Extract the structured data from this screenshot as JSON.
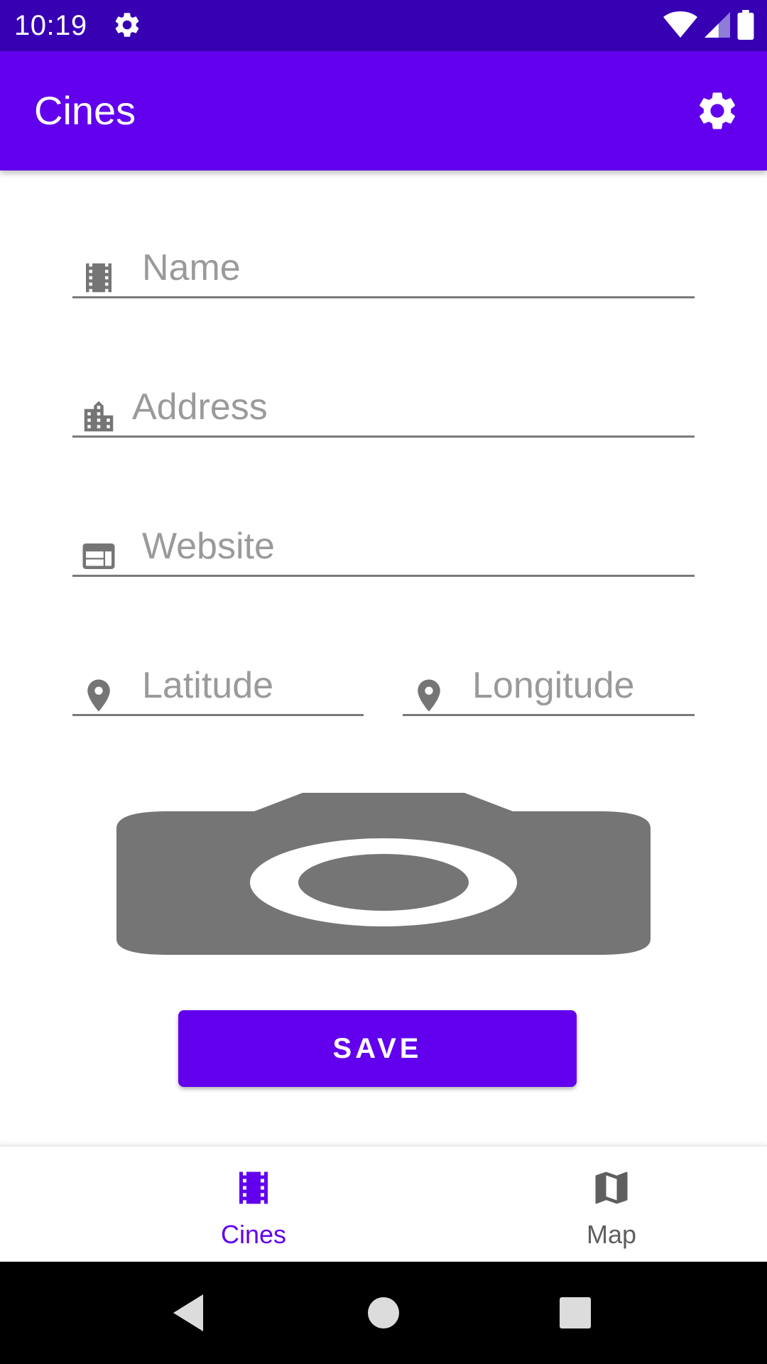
{
  "status_bar": {
    "time": "10:19",
    "icons": [
      "settings-icon",
      "wifi-icon",
      "signal-icon",
      "battery-icon"
    ]
  },
  "app_bar": {
    "title": "Cines",
    "action_icon": "settings-icon"
  },
  "form": {
    "name": {
      "placeholder": "Name",
      "value": "",
      "icon": "movie-film-icon"
    },
    "address": {
      "placeholder": "Address",
      "value": "",
      "icon": "city-building-icon"
    },
    "website": {
      "placeholder": "Website",
      "value": "",
      "icon": "web-icon"
    },
    "latitude": {
      "placeholder": "Latitude",
      "value": "",
      "icon": "location-pin-icon"
    },
    "longitude": {
      "placeholder": "Longitude",
      "value": "",
      "icon": "location-pin-icon"
    },
    "photo_icon": "camera-icon",
    "save_label": "SAVE"
  },
  "bottom_nav": {
    "items": [
      {
        "label": "Cines",
        "icon": "movie-film-icon",
        "selected": true
      },
      {
        "label": "Map",
        "icon": "map-icon",
        "selected": false
      }
    ]
  },
  "system_nav": [
    "back-icon",
    "home-icon",
    "recents-icon"
  ],
  "colors": {
    "primary": "#6200ee",
    "primary_dark": "#3700b3",
    "icon_grey": "#757575",
    "hint_grey": "#9a9a9a"
  }
}
